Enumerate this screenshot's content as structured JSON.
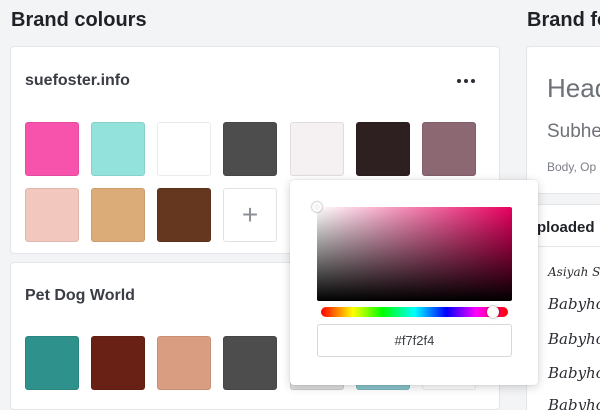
{
  "headings": {
    "brand_colours": "Brand colours",
    "brand_fonts": "Brand fo"
  },
  "kits": [
    {
      "name": "suefoster.info",
      "swatches": [
        "#f752ac",
        "#94e2dc",
        "#ffffff",
        "#4d4d4d",
        "#f5f0f1",
        "#2e2020",
        "#8c6873",
        "#f2c7bd",
        "#dcac78",
        "#65371f"
      ],
      "add_label": "+"
    },
    {
      "name": "Pet Dog World",
      "swatches": [
        "#2e918c",
        "#6a2115",
        "#d99e82",
        "#4d4d4d",
        "#dedede",
        "#87c4cb",
        "#ffffff"
      ]
    }
  ],
  "fonts": {
    "heading": "Head",
    "subheading": "Subhe",
    "body": "Body, Op"
  },
  "uploaded": {
    "title": "ploaded",
    "items": [
      "Asiyah Scri",
      "Babyhom",
      "Babyhom",
      "Babyhom",
      "Babyhom"
    ]
  },
  "color_picker": {
    "hex_value": "#f7f2f4",
    "hue_color": "#e8005f",
    "hue_position": 0.92
  },
  "icons": {
    "more": "more-horizontal-icon",
    "add": "plus-icon"
  }
}
